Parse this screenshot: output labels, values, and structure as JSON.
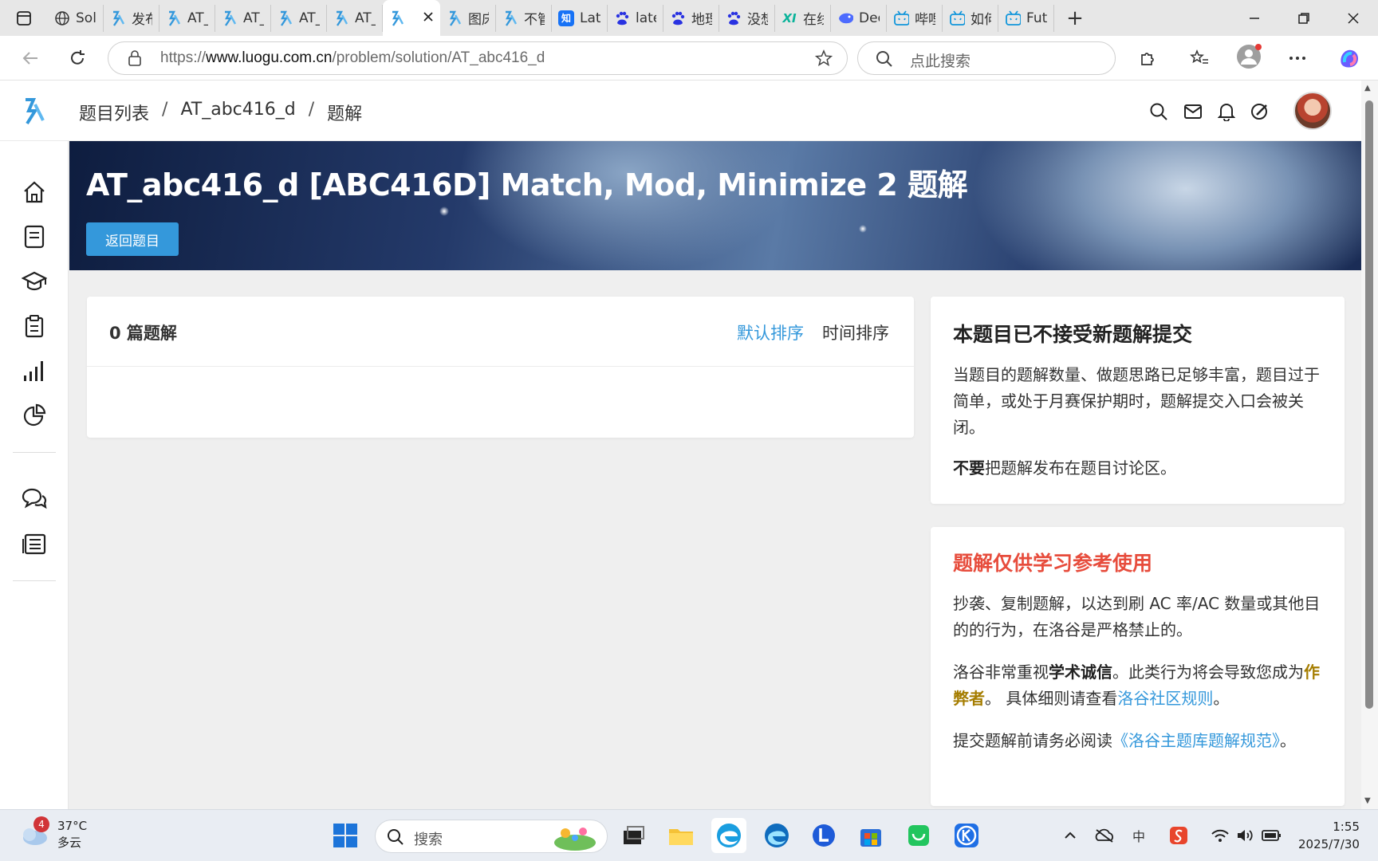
{
  "browser": {
    "tabs": [
      {
        "label": "Solu",
        "icon": "globe-icon"
      },
      {
        "label": "发布",
        "icon": "luogu-icon"
      },
      {
        "label": "AT_",
        "icon": "luogu-icon"
      },
      {
        "label": "AT_",
        "icon": "luogu-icon"
      },
      {
        "label": "AT_",
        "icon": "luogu-icon"
      },
      {
        "label": "AT_",
        "icon": "luogu-icon"
      },
      {
        "label": "",
        "icon": "luogu-icon",
        "active": true
      },
      {
        "label": "图床",
        "icon": "luogu-icon"
      },
      {
        "label": "不管",
        "icon": "luogu-icon"
      },
      {
        "label": "Late",
        "icon": "zhihu-icon"
      },
      {
        "label": "late",
        "icon": "baidu-icon"
      },
      {
        "label": "地理",
        "icon": "baidu-icon"
      },
      {
        "label": "没想",
        "icon": "baidu-icon"
      },
      {
        "label": "在线",
        "icon": "xi-icon"
      },
      {
        "label": "Dee",
        "icon": "deepseek-icon"
      },
      {
        "label": "哔哩",
        "icon": "bilibili-icon"
      },
      {
        "label": "如何",
        "icon": "bilibili-icon"
      },
      {
        "label": "Futu",
        "icon": "bilibili-icon"
      }
    ],
    "url_prefix": "https://",
    "url_host": "www.luogu.com.cn",
    "url_path": "/problem/solution/AT_abc416_d",
    "search_placeholder": "点此搜索"
  },
  "header": {
    "breadcrumb": [
      "题目列表",
      "AT_abc416_d",
      "题解"
    ],
    "separator": "/"
  },
  "banner": {
    "title": "AT_abc416_d [ABC416D] Match, Mod, Minimize 2 题解",
    "back_button": "返回题目"
  },
  "solutions": {
    "count_label": "0 篇题解",
    "sort_default": "默认排序",
    "sort_time": "时间排序"
  },
  "notice": {
    "title": "本题目已不接受新题解提交",
    "body": "当题目的题解数量、做题思路已足够丰富，题目过于简单，或处于月赛保护期时，题解提交入口会被关闭。",
    "dont_strong": "不要",
    "dont_rest": "把题解发布在题目讨论区。"
  },
  "warning": {
    "title": "题解仅供学习参考使用",
    "p1": "抄袭、复制题解，以达到刷 AC 率/AC 数量或其他目的的行为，在洛谷是严格禁止的。",
    "p2_a": "洛谷非常重视",
    "p2_strong": "学术诚信",
    "p2_b": "。此类行为将会导致您成为",
    "p2_gold": "作弊者",
    "p2_c": "。 具体细则请查看",
    "p2_link": "洛谷社区规则",
    "p2_d": "。",
    "p3_a": "提交题解前请务必阅读",
    "p3_link": "《洛谷主题库题解规范》",
    "p3_b": "。"
  },
  "taskbar": {
    "weather_temp": "37°C",
    "weather_desc": "多云",
    "weather_badge": "4",
    "search_placeholder": "搜索",
    "ime": "中",
    "clock_time": "1:55",
    "clock_date": "2025/7/30"
  },
  "colors": {
    "accent": "#3498db",
    "danger": "#e74c3c",
    "gold": "#a57d00"
  }
}
